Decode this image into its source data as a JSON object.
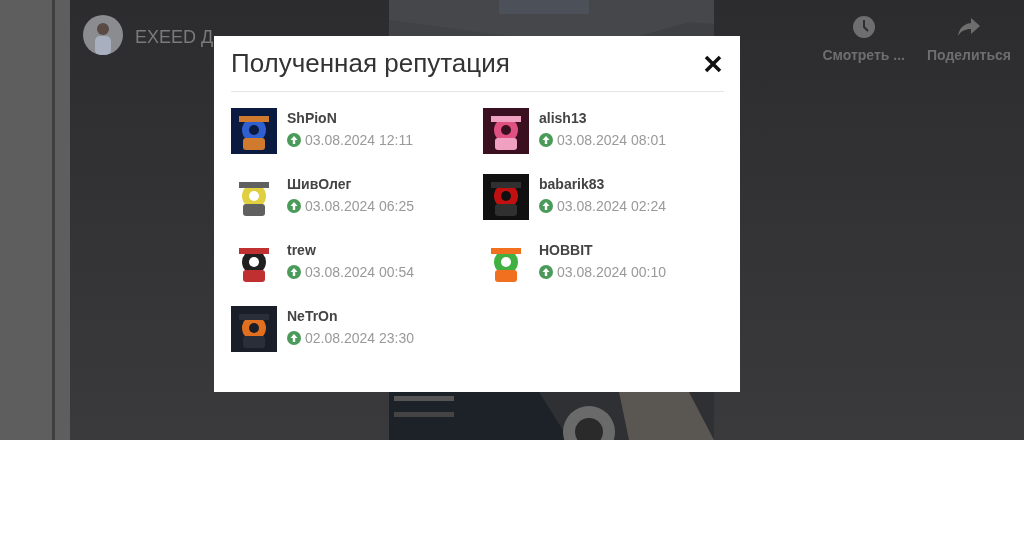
{
  "video": {
    "title": "EXEED Д",
    "actions": [
      {
        "kind": "watch-later",
        "label": "Смотреть ..."
      },
      {
        "kind": "share",
        "label": "Поделиться"
      }
    ]
  },
  "modal": {
    "title": "Полученная репутация",
    "items": [
      {
        "name": "ShPioN",
        "time": "03.08.2024 12:11"
      },
      {
        "name": "alish13",
        "time": "03.08.2024 08:01"
      },
      {
        "name": "ШивОлег",
        "time": "03.08.2024 06:25"
      },
      {
        "name": "babarik83",
        "time": "03.08.2024 02:24"
      },
      {
        "name": "trew",
        "time": "03.08.2024 00:54"
      },
      {
        "name": "HOBBIT",
        "time": "03.08.2024 00:10"
      },
      {
        "name": "NeTrOn",
        "time": "02.08.2024 23:30"
      }
    ]
  }
}
